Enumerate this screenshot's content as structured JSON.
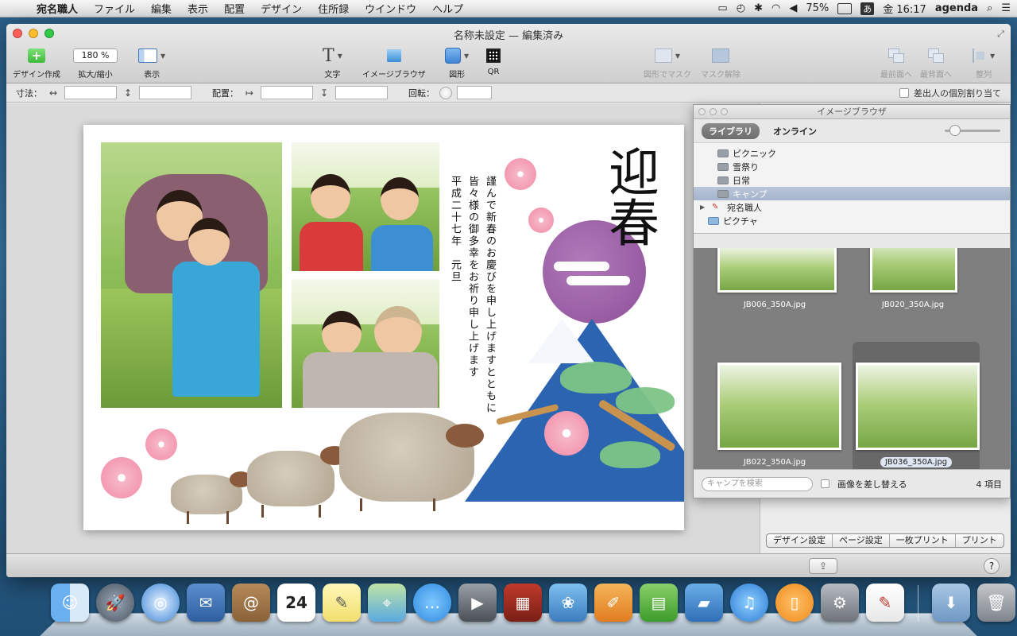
{
  "menubar": {
    "app": "宛名職人",
    "items": [
      "ファイル",
      "編集",
      "表示",
      "配置",
      "デザイン",
      "住所録",
      "ウインドウ",
      "ヘルプ"
    ],
    "battery": "75%",
    "ime": "あ",
    "clock": "金 16:17",
    "user": "agenda"
  },
  "window": {
    "title": "名称未設定 — 編集済み"
  },
  "toolbar": {
    "design_create": "デザイン作成",
    "zoom_value": "180 %",
    "zoom_label": "拡大/縮小",
    "view_label": "表示",
    "text_label": "文字",
    "image_browser_label": "イメージブラウザ",
    "shape_label": "図形",
    "qr_label": "QR",
    "mask_label": "図形でマスク",
    "unmask_label": "マスク解除",
    "front_label": "最前面へ",
    "top_label": "最背面へ",
    "align_label": "整列"
  },
  "dimbar": {
    "size_label": "寸法：",
    "position_label": "配置：",
    "rotate_label": "回転：",
    "individual_label": "差出人の個別割り当て"
  },
  "card": {
    "greeting": "迎春",
    "message_col1": "謹んで新春のお慶びを申し上げますとともに",
    "message_col2": "皆々様の御多幸をお祈り申し上げます",
    "message_col3": "平成二十七年　元旦"
  },
  "image_browser": {
    "title": "イメージブラウザ",
    "tab_library": "ライブラリ",
    "tab_online": "オンライン",
    "folders": [
      {
        "name": "ピクニック",
        "selected": false
      },
      {
        "name": "雪祭り",
        "selected": false
      },
      {
        "name": "日常",
        "selected": false
      },
      {
        "name": "キャンプ",
        "selected": true
      }
    ],
    "groups": [
      {
        "name": "宛名職人"
      },
      {
        "name": "ピクチャ"
      }
    ],
    "thumbnails": [
      {
        "file": "JB006_350A.jpg"
      },
      {
        "file": "JB020_350A.jpg"
      },
      {
        "file": "JB022_350A.jpg"
      },
      {
        "file": "JB036_350A.jpg"
      }
    ],
    "search_placeholder": "キャンプを検索",
    "replace_label": "画像を差し替える",
    "count": "4 項目"
  },
  "bottom_tabs": {
    "design_settings": "デザイン設定",
    "page_settings": "ページ設定",
    "single_print": "一枚プリント",
    "print": "プリント"
  },
  "status": {
    "help": "?"
  },
  "dock": {
    "calendar_day": "24"
  }
}
